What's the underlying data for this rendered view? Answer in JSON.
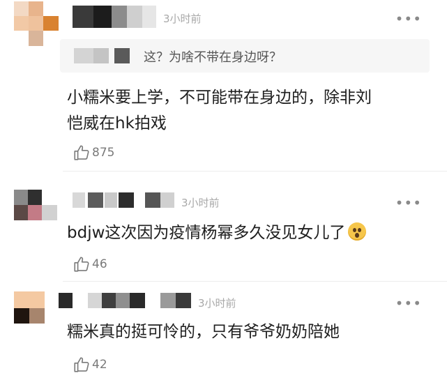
{
  "comments": [
    {
      "time": "3小时前",
      "more": "•••",
      "quote": "这？为啥不带在身边呀？",
      "text_lines": [
        "小糯米要上学，不可能带在身边的，除非刘",
        "恺威在hk拍戏"
      ],
      "likes": "875"
    },
    {
      "time": "3小时前",
      "more": "•••",
      "text": "bdjw这次因为疫情杨幂多久没见女儿了",
      "emoji": "hushed-face-emoji",
      "likes": "46"
    },
    {
      "time": "3小时前",
      "more": "•••",
      "text": "糯米真的挺可怜的，只有爷爷奶奶陪她",
      "likes": "42"
    }
  ],
  "icons": {
    "like": "thumbs-up-outline-icon",
    "more": "more-dots-icon"
  }
}
